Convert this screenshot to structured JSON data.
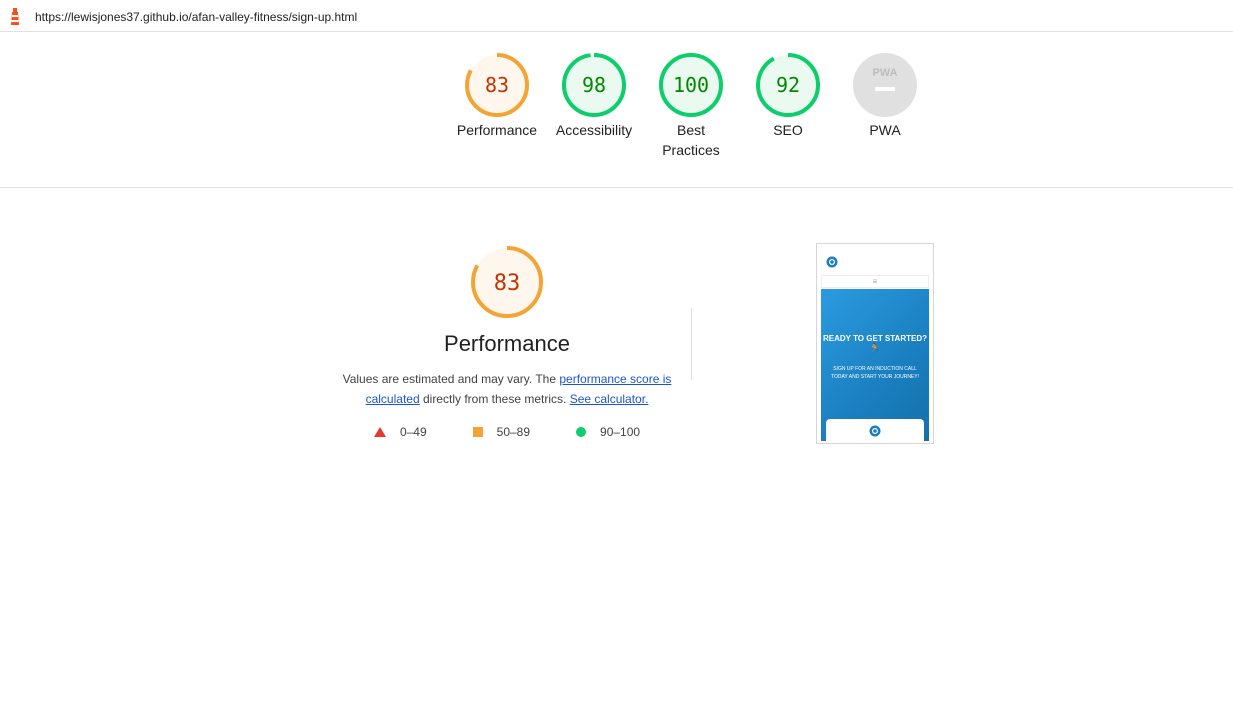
{
  "header": {
    "url": "https://lewisjones37.github.io/afan-valley-fitness/sign-up.html"
  },
  "colors": {
    "pass": "#0cce6b",
    "average": "#f4a434",
    "fail": "#e53935",
    "pass_text": "#008800",
    "average_text": "#c33300",
    "link": "#1a55d5"
  },
  "gauges": [
    {
      "label": "Performance",
      "score": "83",
      "value": 83,
      "rating": "average"
    },
    {
      "label": "Accessibility",
      "score": "98",
      "value": 98,
      "rating": "pass"
    },
    {
      "label": "Best Practices",
      "score": "100",
      "value": 100,
      "rating": "pass"
    },
    {
      "label": "SEO",
      "score": "92",
      "value": 92,
      "rating": "pass"
    },
    {
      "label": "PWA",
      "score": "PWA",
      "value": 0,
      "rating": "na"
    }
  ],
  "performance": {
    "score": "83",
    "value": 83,
    "title": "Performance",
    "desc_prefix": "Values are estimated and may vary. The ",
    "link1": "performance score is calculated",
    "desc_middle": " directly from these metrics. ",
    "link2": "See calculator."
  },
  "legend": [
    {
      "icon": "fail-triangle-icon",
      "range": "0–49"
    },
    {
      "icon": "average-square-icon",
      "range": "50–89"
    },
    {
      "icon": "pass-circle-icon",
      "range": "90–100"
    }
  ],
  "screenshot": {
    "menu_icon": "≡",
    "hero_title": "READY TO GET STARTED?",
    "hero_runner": "🏃",
    "hero_sub": "SIGN UP FOR AN INDUCTION CALL TODAY AND START YOUR JOURNEY!"
  }
}
